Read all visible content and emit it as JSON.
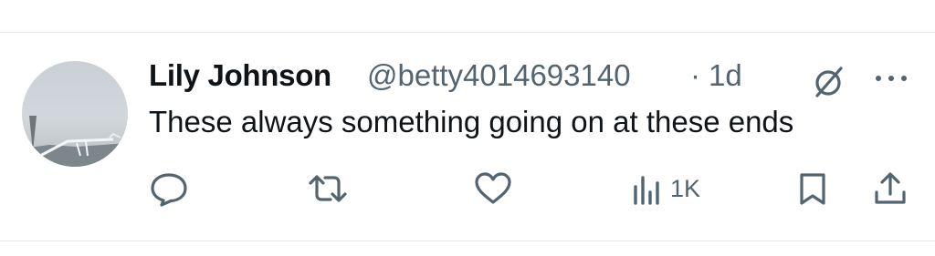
{
  "tweet": {
    "author_name": "Lily Johnson",
    "handle": "@betty4014693140",
    "separator": "·",
    "time": "1d",
    "text": "These always something going on at these ends"
  },
  "actions": {
    "views_count": "1K"
  },
  "icons": [
    "reply-icon",
    "retweet-icon",
    "like-icon",
    "views-icon",
    "bookmark-icon",
    "share-icon",
    "grok-icon",
    "more-icon"
  ]
}
